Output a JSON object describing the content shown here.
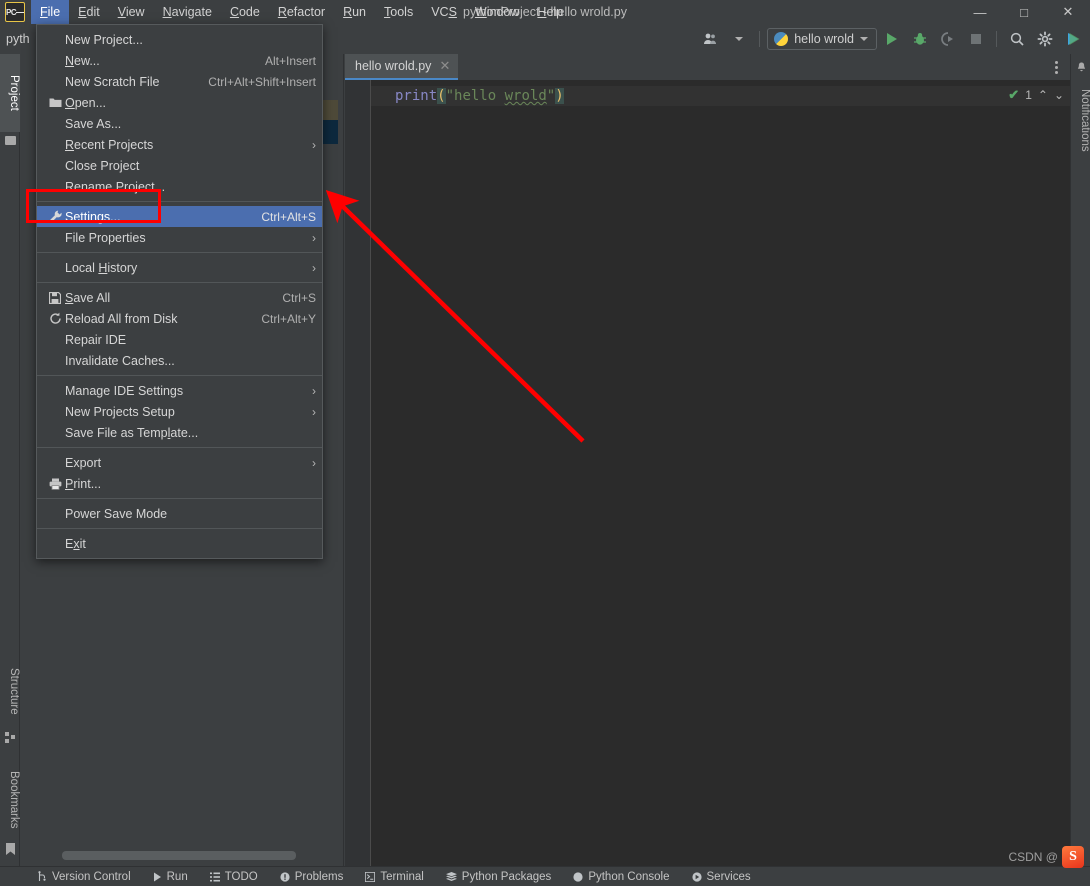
{
  "window": {
    "title": "pythonProject - hello wrold.py",
    "controls": {
      "minimize": "—",
      "maximize": "□",
      "close": "✕"
    },
    "logo_text": "PC"
  },
  "menubar": {
    "items": [
      {
        "label": "File",
        "mnemonic": "F",
        "active": true
      },
      {
        "label": "Edit",
        "mnemonic": "E",
        "active": false
      },
      {
        "label": "View",
        "mnemonic": "V",
        "active": false
      },
      {
        "label": "Navigate",
        "mnemonic": "N",
        "active": false
      },
      {
        "label": "Code",
        "mnemonic": "C",
        "active": false
      },
      {
        "label": "Refactor",
        "mnemonic": "R",
        "active": false
      },
      {
        "label": "Run",
        "mnemonic": "R",
        "active": false
      },
      {
        "label": "Tools",
        "mnemonic": "T",
        "active": false
      },
      {
        "label": "VCS",
        "mnemonic": "S",
        "active": false
      },
      {
        "label": "Window",
        "mnemonic": "W",
        "active": false
      },
      {
        "label": "Help",
        "mnemonic": "H",
        "active": false
      }
    ]
  },
  "file_menu": {
    "items": [
      {
        "label": "New Project...",
        "accel": "",
        "icon": "",
        "submenu": false,
        "highlighted": false,
        "mnemonic": ""
      },
      {
        "label": "New...",
        "accel": "Alt+Insert",
        "icon": "",
        "submenu": false,
        "highlighted": false,
        "mnemonic": "N"
      },
      {
        "label": "New Scratch File",
        "accel": "Ctrl+Alt+Shift+Insert",
        "icon": "",
        "submenu": false,
        "highlighted": false,
        "mnemonic": ""
      },
      {
        "label": "Open...",
        "accel": "",
        "icon": "folder-icon",
        "submenu": false,
        "highlighted": false,
        "mnemonic": "O"
      },
      {
        "label": "Save As...",
        "accel": "",
        "icon": "",
        "submenu": false,
        "highlighted": false,
        "mnemonic": ""
      },
      {
        "label": "Recent Projects",
        "accel": "",
        "icon": "",
        "submenu": true,
        "highlighted": false,
        "mnemonic": "R"
      },
      {
        "label": "Close Project",
        "accel": "",
        "icon": "",
        "submenu": false,
        "highlighted": false,
        "mnemonic": ""
      },
      {
        "label": "Rename Project...",
        "accel": "",
        "icon": "",
        "submenu": false,
        "highlighted": false,
        "mnemonic": ""
      },
      {
        "separator": true
      },
      {
        "label": "Settings...",
        "accel": "Ctrl+Alt+S",
        "icon": "wrench-icon",
        "submenu": false,
        "highlighted": true,
        "mnemonic": "tt"
      },
      {
        "label": "File Properties",
        "accel": "",
        "icon": "",
        "submenu": true,
        "highlighted": false,
        "mnemonic": ""
      },
      {
        "separator": true
      },
      {
        "label": "Local History",
        "accel": "",
        "icon": "",
        "submenu": true,
        "highlighted": false,
        "mnemonic": "H"
      },
      {
        "separator": true
      },
      {
        "label": "Save All",
        "accel": "Ctrl+S",
        "icon": "save-icon",
        "submenu": false,
        "highlighted": false,
        "mnemonic": "S"
      },
      {
        "label": "Reload All from Disk",
        "accel": "Ctrl+Alt+Y",
        "icon": "reload-icon",
        "submenu": false,
        "highlighted": false,
        "mnemonic": ""
      },
      {
        "label": "Repair IDE",
        "accel": "",
        "icon": "",
        "submenu": false,
        "highlighted": false,
        "mnemonic": ""
      },
      {
        "label": "Invalidate Caches...",
        "accel": "",
        "icon": "",
        "submenu": false,
        "highlighted": false,
        "mnemonic": ""
      },
      {
        "separator": true
      },
      {
        "label": "Manage IDE Settings",
        "accel": "",
        "icon": "",
        "submenu": true,
        "highlighted": false,
        "mnemonic": ""
      },
      {
        "label": "New Projects Setup",
        "accel": "",
        "icon": "",
        "submenu": true,
        "highlighted": false,
        "mnemonic": ""
      },
      {
        "label": "Save File as Template...",
        "accel": "",
        "icon": "",
        "submenu": false,
        "highlighted": false,
        "mnemonic": "l"
      },
      {
        "separator": true
      },
      {
        "label": "Export",
        "accel": "",
        "icon": "",
        "submenu": true,
        "highlighted": false,
        "mnemonic": ""
      },
      {
        "label": "Print...",
        "accel": "",
        "icon": "printer-icon",
        "submenu": false,
        "highlighted": false,
        "mnemonic": "P"
      },
      {
        "separator": true
      },
      {
        "label": "Power Save Mode",
        "accel": "",
        "icon": "",
        "submenu": false,
        "highlighted": false,
        "mnemonic": ""
      },
      {
        "separator": true
      },
      {
        "label": "Exit",
        "accel": "",
        "icon": "",
        "submenu": false,
        "highlighted": false,
        "mnemonic": "x"
      }
    ]
  },
  "toolbar": {
    "project_label": "pyth",
    "account_icon": "user-icon",
    "run_config": {
      "name": "hello wrold",
      "icon": "python-icon"
    },
    "run_label": "Run",
    "debug_label": "Debug",
    "run_coverage_label": "Run with Coverage",
    "stop_label": "Stop",
    "search_label": "Search Everywhere",
    "settings_label": "Settings",
    "updates_label": "Updates"
  },
  "left_tabs": [
    {
      "label": "Project",
      "icon": "folder-icon",
      "selected": true
    },
    {
      "label": "Structure",
      "icon": "structure-icon",
      "selected": false
    },
    {
      "label": "Bookmarks",
      "icon": "bookmark-icon",
      "selected": false
    }
  ],
  "right_tabs": [
    {
      "label": "Notifications",
      "icon": "bell-icon",
      "selected": false
    }
  ],
  "editor": {
    "tab": {
      "name": "hello wrold.py",
      "close": "✕"
    },
    "more_options": "more-options",
    "code": {
      "keyword": "print",
      "open_paren": "(",
      "string": "\"hello ",
      "string_typo": "wrold",
      "string_end": "\"",
      "close_paren": ")"
    },
    "inspection": {
      "count": "1",
      "status_icon": "checkmark-icon",
      "up": "⌃",
      "down": "⌄"
    }
  },
  "statusbar": {
    "items": [
      {
        "label": "Version Control",
        "icon": "branch-icon"
      },
      {
        "label": "Run",
        "icon": "play-icon"
      },
      {
        "label": "TODO",
        "icon": "list-icon"
      },
      {
        "label": "Problems",
        "icon": "warning-icon"
      },
      {
        "label": "Terminal",
        "icon": "terminal-icon"
      },
      {
        "label": "Python Packages",
        "icon": "packages-icon"
      },
      {
        "label": "Python Console",
        "icon": "python-icon"
      },
      {
        "label": "Services",
        "icon": "services-icon"
      }
    ]
  },
  "annotations": {
    "highlight_box_target": "Settings...",
    "arrow_color": "#fe0000",
    "box_color": "#fe0000"
  },
  "watermark": {
    "text": "CSDN @",
    "logo": "S"
  },
  "colors": {
    "bg": "#3c3f41",
    "editor_bg": "#2b2b2b",
    "accent_blue": "#4b6eaf",
    "tab_underline": "#4a88c7",
    "green": "#59a869",
    "annotation_red": "#fe0000",
    "string_green": "#6a8759",
    "keyword_purple": "#8888c6",
    "paren_yellow": "#e8bf6a"
  }
}
